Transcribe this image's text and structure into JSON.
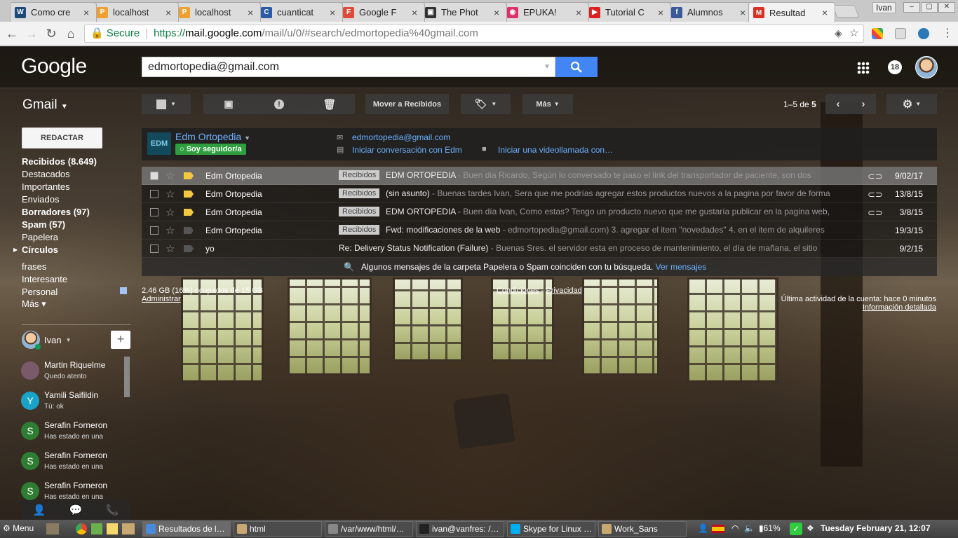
{
  "browser": {
    "tabs": [
      {
        "title": "Como cre",
        "icon": "wordpress-icon",
        "color": "#1e4a7a",
        "glyph": "W"
      },
      {
        "title": "localhost",
        "icon": "phpmyadmin-icon",
        "color": "#f0a030",
        "glyph": "P"
      },
      {
        "title": "localhost",
        "icon": "phpmyadmin-icon",
        "color": "#f0a030",
        "glyph": "P"
      },
      {
        "title": "cuanticat",
        "icon": "shield-icon",
        "color": "#2a5aa8",
        "glyph": "C"
      },
      {
        "title": "Google F",
        "icon": "google-fonts-icon",
        "color": "#e04a3a",
        "glyph": "F"
      },
      {
        "title": "The Phot",
        "icon": "camera-icon",
        "color": "#333333",
        "glyph": "▣"
      },
      {
        "title": "EPUKA!",
        "icon": "epuka-icon",
        "color": "#e0306a",
        "glyph": "◉"
      },
      {
        "title": "Tutorial C",
        "icon": "youtube-icon",
        "color": "#e02020",
        "glyph": "▶"
      },
      {
        "title": "Alumnos",
        "icon": "facebook-icon",
        "color": "#3b5998",
        "glyph": "f"
      },
      {
        "title": "Resultad",
        "icon": "gmail-icon",
        "color": "#d93025",
        "glyph": "M",
        "active": true
      }
    ],
    "user": "Ivan",
    "address": {
      "secure": "Secure",
      "scheme": "https://",
      "host": "mail.google.com",
      "path": "/mail/u/0/#search/edmortopedia%40gmail.com"
    }
  },
  "gmail": {
    "logo": "Google",
    "search_value": "edmortopedia@gmail.com",
    "notifications": "18",
    "app_label": "Gmail",
    "toolbar": {
      "move_label": "Mover a Recibidos",
      "more_label": "Más"
    },
    "pager": {
      "range": "1–5",
      "of": "de",
      "total": "5"
    },
    "compose": "REDACTAR",
    "nav": [
      {
        "label": "Recibidos (8.649)",
        "bold": true
      },
      {
        "label": "Destacados",
        "bold": false
      },
      {
        "label": "Importantes",
        "bold": false
      },
      {
        "label": "Enviados",
        "bold": false
      },
      {
        "label": "Borradores (97)",
        "bold": true
      },
      {
        "label": "Spam (57)",
        "bold": true
      },
      {
        "label": "Papelera",
        "bold": false
      },
      {
        "label": "Círculos",
        "bold": true
      },
      {
        "label": "frases",
        "bold": false
      },
      {
        "label": "Interesante",
        "bold": false
      },
      {
        "label": "Personal",
        "bold": false
      },
      {
        "label": "Más ▾",
        "bold": false
      }
    ],
    "hangouts": {
      "me": "Ivan",
      "contacts": [
        {
          "name": "Martin Riquelme",
          "status": "Quedo atento",
          "initial": "",
          "color": "#7a5a6a"
        },
        {
          "name": "Yamili Saifildin",
          "status": "Tú: ok",
          "initial": "Y",
          "color": "#1aa3c8"
        },
        {
          "name": "Serafin Forneron",
          "status": "Has estado en una",
          "initial": "S",
          "color": "#2e7d32"
        },
        {
          "name": "Serafin Forneron",
          "status": "Has estado en una",
          "initial": "S",
          "color": "#2e7d32"
        },
        {
          "name": "Serafin Forneron",
          "status": "Has estado en una",
          "initial": "S",
          "color": "#2e7d32"
        }
      ]
    },
    "contact_card": {
      "name": "Edm Ortopedia",
      "logo": "EDM",
      "follow": "Soy seguidor/a",
      "email": "edmortopedia@gmail.com",
      "chat": "Iniciar conversación con Edm",
      "video": "Iniciar una videollamada con…"
    },
    "messages": [
      {
        "sender": "Edm Ortopedia",
        "label": "Recibidos",
        "subject": "EDM ORTOPEDIA",
        "snippet": " - Buen dia Ricardo, Según lo conversado te paso el link del transportador de paciente, son dos",
        "date": "9/02/17",
        "selected": true,
        "important": true,
        "attachment": true
      },
      {
        "sender": "Edm Ortopedia",
        "label": "Recibidos",
        "subject": "(sin asunto)",
        "snippet": " - Buenas tardes Ivan, Sera que me podrías agregar estos productos nuevos a la pagina por favor de forma",
        "date": "13/8/15",
        "selected": false,
        "important": true,
        "attachment": true
      },
      {
        "sender": "Edm Ortopedia",
        "label": "Recibidos",
        "subject": "EDM ORTOPEDIA",
        "snippet": " - Buen día Ivan, Como estas? Tengo un producto nuevo que me gustaría publicar en la pagina web,",
        "date": "3/8/15",
        "selected": false,
        "important": true,
        "attachment": true
      },
      {
        "sender": "Edm Ortopedia",
        "label": "Recibidos",
        "subject": "Fwd: modificaciones de la web",
        "snippet": " - edmortopedia@gmail.com) 3. agregar el item \"novedades\" 4. en el item de alquileres",
        "date": "19/3/15",
        "selected": false,
        "important": false,
        "attachment": false
      },
      {
        "sender": "yo",
        "label": "",
        "subject": "Re: Delivery Status Notification (Failure)",
        "snippet": " - Buenas Sres. el servidor esta en proceso de mantenimiento, el día de mañana, el sitio",
        "date": "9/2/15",
        "selected": false,
        "important": false,
        "attachment": false
      }
    ],
    "notice": {
      "text": "Algunos mensajes de la carpeta Papelera o Spam coinciden con tu búsqueda.",
      "link": "Ver mensajes"
    },
    "footer": {
      "storage": "2,46 GB (16%) ocupados de 15 GB",
      "manage": "Administrar",
      "terms": "Condiciones",
      "dash": "-",
      "privacy": "Privacidad",
      "activity": "Última actividad de la cuenta: hace 0 minutos",
      "details": "Información detallada"
    }
  },
  "taskbar": {
    "menu": "Menu",
    "windows": [
      {
        "title": "Resultados de l…",
        "color": "#4a8ad8"
      },
      {
        "title": "html",
        "color": "#c8a870"
      },
      {
        "title": "/var/www/html/…",
        "color": "#888888"
      },
      {
        "title": "ivan@vanfres: /…",
        "color": "#222222"
      },
      {
        "title": "Skype for Linux …",
        "color": "#00aff0"
      },
      {
        "title": "Work_Sans",
        "color": "#c8a870"
      }
    ],
    "battery": "61%",
    "clock": "Tuesday February 21, 12:07"
  }
}
